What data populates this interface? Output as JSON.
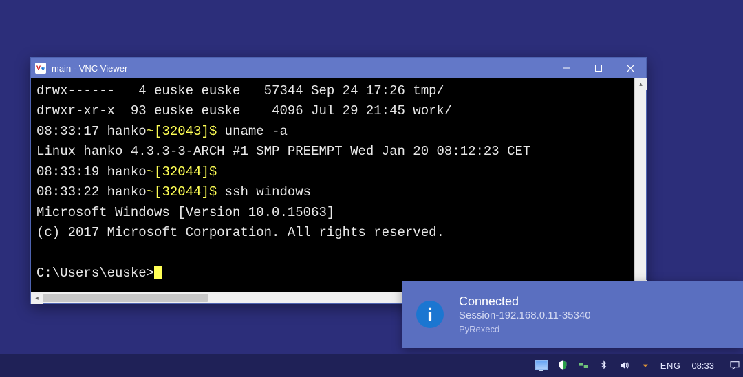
{
  "window": {
    "title": "main - VNC Viewer"
  },
  "terminal": {
    "lines": [
      {
        "segments": [
          {
            "t": "drwx------   4 euske euske   57344 Sep 24 17:26 tmp/"
          }
        ]
      },
      {
        "segments": [
          {
            "t": "drwxr-xr-x  93 euske euske    4096 Jul 29 21:45 work/"
          }
        ]
      },
      {
        "segments": [
          {
            "t": "08:33:17 hanko"
          },
          {
            "t": "~[32043]$",
            "c": "yellow"
          },
          {
            "t": " uname -a"
          }
        ]
      },
      {
        "segments": [
          {
            "t": "Linux hanko 4.3.3-3-ARCH #1 SMP PREEMPT Wed Jan 20 08:12:23 CET"
          }
        ]
      },
      {
        "segments": [
          {
            "t": "08:33:19 hanko"
          },
          {
            "t": "~[32044]$",
            "c": "yellow"
          }
        ]
      },
      {
        "segments": [
          {
            "t": "08:33:22 hanko"
          },
          {
            "t": "~[32044]$",
            "c": "yellow"
          },
          {
            "t": " ssh windows"
          }
        ]
      },
      {
        "segments": [
          {
            "t": "Microsoft Windows [Version 10.0.15063]"
          }
        ]
      },
      {
        "segments": [
          {
            "t": "(c) 2017 Microsoft Corporation. All rights reserved."
          }
        ]
      },
      {
        "segments": [
          {
            "t": " "
          }
        ]
      },
      {
        "segments": [
          {
            "t": "C:\\Users\\euske>"
          }
        ],
        "cursor": true
      }
    ]
  },
  "toast": {
    "title": "Connected",
    "subtitle": "Session-192.168.0.11-35340",
    "app": "PyRexecd"
  },
  "taskbar": {
    "lang": "ENG",
    "clock": "08:33"
  }
}
